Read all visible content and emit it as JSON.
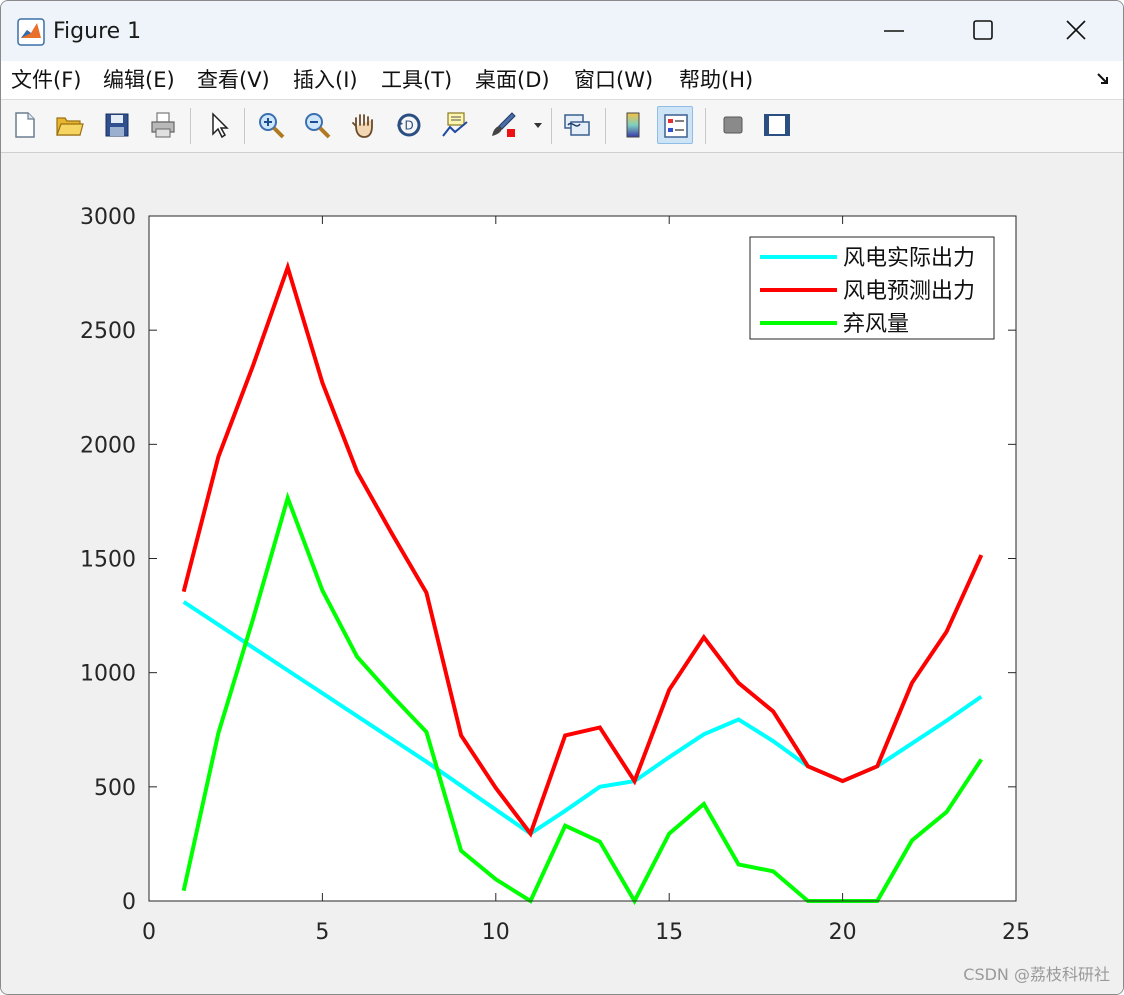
{
  "window": {
    "title": "Figure 1"
  },
  "menu": {
    "items": [
      "文件(F)",
      "编辑(E)",
      "查看(V)",
      "插入(I)",
      "工具(T)",
      "桌面(D)",
      "窗口(W)",
      "帮助(H)"
    ]
  },
  "toolbar": {
    "icons": [
      "new-file-icon",
      "open-folder-icon",
      "save-icon",
      "print-icon",
      "pointer-icon",
      "zoom-in-icon",
      "zoom-out-icon",
      "pan-hand-icon",
      "rotate-3d-icon",
      "data-cursor-icon",
      "brush-icon",
      "link-plot-icon",
      "colorbar-icon",
      "legend-icon",
      "hide-plot-tools-icon",
      "show-plot-tools-icon"
    ]
  },
  "watermark": "CSDN @荔枝科研社",
  "colors": {
    "actual": "#00ffff",
    "forecast": "#ff0000",
    "curtailment": "#00ff00"
  },
  "chart_data": {
    "type": "line",
    "title": "",
    "xlabel": "",
    "ylabel": "",
    "xlim": [
      0,
      25
    ],
    "ylim": [
      0,
      3000
    ],
    "xticks": [
      0,
      5,
      10,
      15,
      20,
      25
    ],
    "yticks": [
      0,
      500,
      1000,
      1500,
      2000,
      2500,
      3000
    ],
    "grid": false,
    "legend_position": "top-right",
    "x": [
      1,
      2,
      3,
      4,
      5,
      6,
      7,
      8,
      9,
      10,
      11,
      12,
      13,
      14,
      15,
      16,
      17,
      18,
      19,
      20,
      21,
      22,
      23,
      24
    ],
    "series": [
      {
        "name": "风电实际出力",
        "color": "#00ffff",
        "values": [
          1310,
          1210,
          1110,
          1010,
          910,
          810,
          710,
          610,
          505,
          400,
          295,
          395,
          500,
          525,
          630,
          730,
          795,
          700,
          590,
          525,
          590,
          690,
          790,
          895
        ]
      },
      {
        "name": "风电预测出力",
        "color": "#ff0000",
        "values": [
          1355,
          1945,
          2345,
          2775,
          2270,
          1880,
          1610,
          1350,
          725,
          495,
          295,
          725,
          760,
          525,
          925,
          1155,
          955,
          830,
          590,
          525,
          590,
          955,
          1180,
          1515
        ]
      },
      {
        "name": "弃风量",
        "color": "#00ff00",
        "values": [
          45,
          735,
          1235,
          1765,
          1360,
          1070,
          900,
          740,
          220,
          95,
          0,
          330,
          260,
          0,
          295,
          425,
          160,
          130,
          0,
          0,
          0,
          265,
          390,
          620
        ]
      }
    ]
  }
}
